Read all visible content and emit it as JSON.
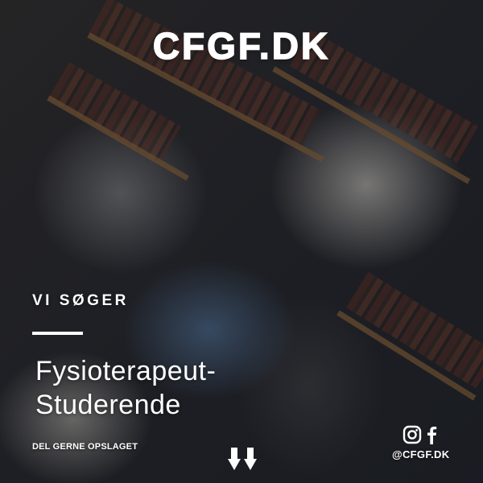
{
  "logo": {
    "text": "CFGF.DK"
  },
  "poster": {
    "kicker": "VI SØGER",
    "headline_line1": "Fysioterapeut-",
    "headline_line2": "Studerende",
    "share_text": "DEL GERNE OPSLAGET"
  },
  "social": {
    "icons": [
      "instagram-icon",
      "facebook-icon"
    ],
    "handle": "@CFGF.DK"
  },
  "colors": {
    "text": "#ffffff",
    "shelf_wood": "#7a5a36"
  }
}
